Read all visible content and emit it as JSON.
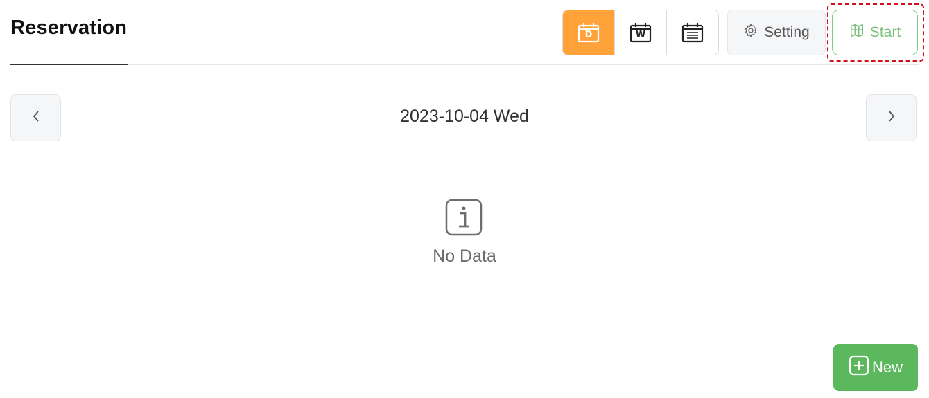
{
  "header": {
    "title": "Reservation",
    "view_modes": [
      {
        "letter": "D",
        "active": true,
        "icon": "calendar-day-icon"
      },
      {
        "letter": "W",
        "active": false,
        "icon": "calendar-week-icon"
      },
      {
        "letter": "",
        "active": false,
        "icon": "calendar-list-icon"
      }
    ],
    "setting_label": "Setting",
    "setting_icon": "gear-icon",
    "start_label": "Start",
    "start_icon": "map-icon"
  },
  "navigation": {
    "current_date": "2023-10-04 Wed",
    "prev_icon": "chevron-left-icon",
    "next_icon": "chevron-right-icon"
  },
  "empty_state": {
    "icon": "info-icon",
    "message": "No Data"
  },
  "footer": {
    "new_label": "New",
    "new_icon": "plus-square-icon"
  },
  "colors": {
    "active_view": "#ffa23a",
    "start_green": "#7cc07c",
    "new_green": "#5cb85c",
    "highlight_red": "#d0101b"
  }
}
